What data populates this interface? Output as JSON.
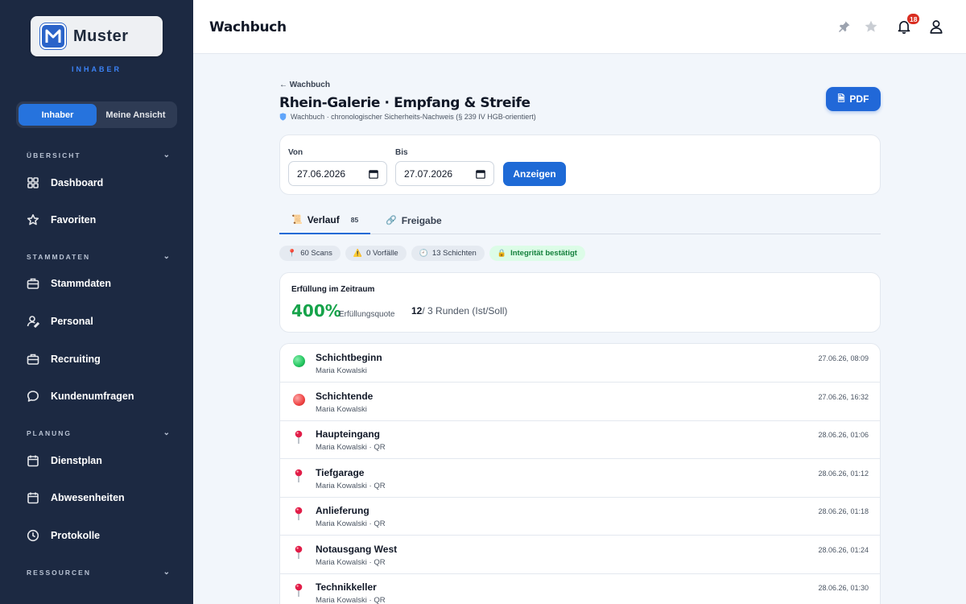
{
  "sidebar": {
    "logo_text": "Muster",
    "role": "INHABER",
    "toggle": [
      "Inhaber",
      "Meine Ansicht"
    ],
    "sections": {
      "overview": "ÜBERSICHT",
      "master": "STAMMDATEN",
      "planning": "PLANUNG",
      "resources": "RESSOURCEN"
    },
    "items": {
      "dashboard": "Dashboard",
      "favorites": "Favoriten",
      "stammdaten": "Stammdaten",
      "personal": "Personal",
      "recruiting": "Recruiting",
      "surveys": "Kundenumfragen",
      "schedule": "Dienstplan",
      "absences": "Abwesenheiten",
      "protocols": "Protokolle"
    }
  },
  "header": {
    "title": "Wachbuch",
    "notification_count": "18"
  },
  "page": {
    "back_label": "← Wachbuch",
    "title": "Rhein-Galerie · Empfang & Streife",
    "subtitle": "Wachbuch · chronologischer Sicherheits-Nachweis (§ 239 IV HGB-orientiert)",
    "pdf_label": "PDF"
  },
  "filter": {
    "from_label": "Von",
    "from_value": "27.06.2026",
    "to_label": "Bis",
    "to_value": "27.07.2026",
    "show_label": "Anzeigen"
  },
  "tabs": {
    "history_label": "Verlauf",
    "history_count": "85",
    "share_label": "Freigabe"
  },
  "chips": {
    "scans": "60 Scans",
    "incidents": "0 Vorfälle",
    "shifts": "13 Schichten",
    "integrity": "Integrität bestätigt"
  },
  "fulfillment": {
    "title": "Erfüllung im Zeitraum",
    "percent": "400%",
    "percent_label": "Erfüllungsquote",
    "rounds_actual": "12",
    "rounds_rest": "/ 3 Runden (Ist/Soll)"
  },
  "entries": [
    {
      "title": "Schichtbeginn",
      "sub": "Maria Kowalski",
      "time": "27.06.26, 08:09",
      "type": "start"
    },
    {
      "title": "Schichtende",
      "sub": "Maria Kowalski",
      "time": "27.06.26, 16:32",
      "type": "end"
    },
    {
      "title": "Haupteingang",
      "sub": "Maria Kowalski  · QR",
      "time": "28.06.26, 01:06",
      "type": "scan"
    },
    {
      "title": "Tiefgarage",
      "sub": "Maria Kowalski  · QR",
      "time": "28.06.26, 01:12",
      "type": "scan"
    },
    {
      "title": "Anlieferung",
      "sub": "Maria Kowalski  · QR",
      "time": "28.06.26, 01:18",
      "type": "scan"
    },
    {
      "title": "Notausgang West",
      "sub": "Maria Kowalski  · QR",
      "time": "28.06.26, 01:24",
      "type": "scan"
    },
    {
      "title": "Technikkeller",
      "sub": "Maria Kowalski  · QR",
      "time": "28.06.26, 01:30",
      "type": "scan"
    }
  ],
  "colors": {
    "primary": "#1e6ad6",
    "sidebar": "#1c2942",
    "success": "#16a34a",
    "start_dot": "#22c55e",
    "end_dot": "#ef4444"
  }
}
